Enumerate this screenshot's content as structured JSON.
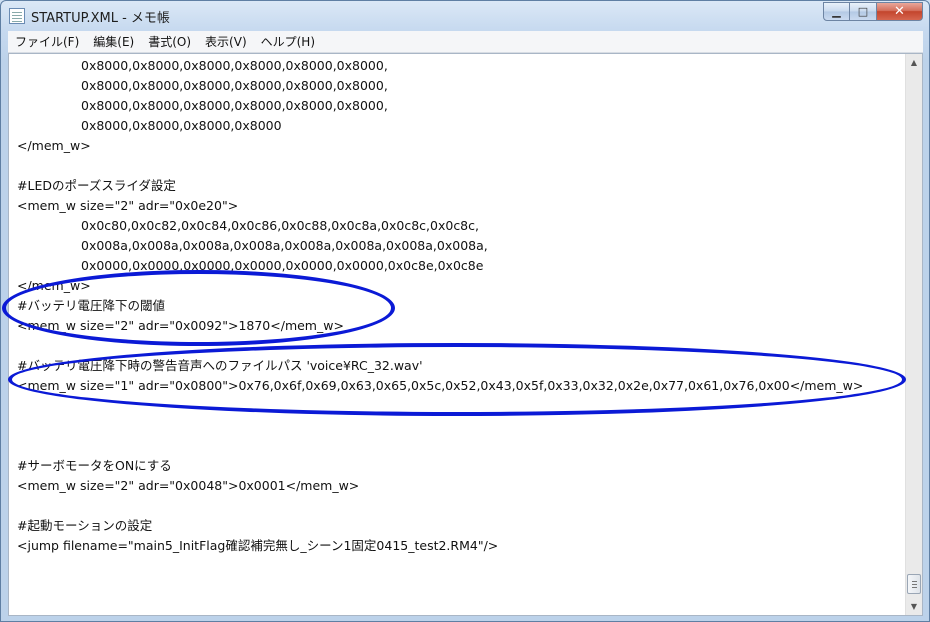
{
  "window": {
    "title": "STARTUP.XML - メモ帳",
    "minimize_glyph": "▁",
    "maximize_glyph": "□",
    "close_glyph": "✕"
  },
  "menu": {
    "items": [
      {
        "label": "ファイル(F)"
      },
      {
        "label": "編集(E)"
      },
      {
        "label": "書式(O)"
      },
      {
        "label": "表示(V)"
      },
      {
        "label": "ヘルプ(H)"
      }
    ]
  },
  "editor": {
    "lines": [
      {
        "text": "0x8000,0x8000,0x8000,0x8000,0x8000,0x8000,",
        "indent": true
      },
      {
        "text": "0x8000,0x8000,0x8000,0x8000,0x8000,0x8000,",
        "indent": true
      },
      {
        "text": "0x8000,0x8000,0x8000,0x8000,0x8000,0x8000,",
        "indent": true
      },
      {
        "text": "0x8000,0x8000,0x8000,0x8000",
        "indent": true
      },
      {
        "text": "</mem_w>",
        "indent": false
      },
      {
        "text": "",
        "indent": false
      },
      {
        "text": "#LEDのポーズスライダ設定",
        "indent": false
      },
      {
        "text": "<mem_w size=\"2\" adr=\"0x0e20\">",
        "indent": false
      },
      {
        "text": "0x0c80,0x0c82,0x0c84,0x0c86,0x0c88,0x0c8a,0x0c8c,0x0c8c,",
        "indent": true
      },
      {
        "text": "0x008a,0x008a,0x008a,0x008a,0x008a,0x008a,0x008a,0x008a,",
        "indent": true
      },
      {
        "text": "0x0000,0x0000,0x0000,0x0000,0x0000,0x0000,0x0c8e,0x0c8e",
        "indent": true
      },
      {
        "text": "</mem_w>",
        "indent": false
      },
      {
        "text": "#バッテリ電圧降下の閾値",
        "indent": false
      },
      {
        "text": "<mem_w size=\"2\" adr=\"0x0092\">1870</mem_w>",
        "indent": false
      },
      {
        "text": "",
        "indent": false
      },
      {
        "text": "#バッテリ電圧降下時の警告音声へのファイルパス 'voice¥RC_32.wav'",
        "indent": false
      },
      {
        "text": "<mem_w size=\"1\" adr=\"0x0800\">0x76,0x6f,0x69,0x63,0x65,0x5c,0x52,0x43,0x5f,0x33,0x32,0x2e,0x77,0x61,0x76,0x00</mem_w>",
        "indent": false
      },
      {
        "text": "",
        "indent": false
      },
      {
        "text": "",
        "indent": false
      },
      {
        "text": "",
        "indent": false
      },
      {
        "text": "#サーボモータをONにする",
        "indent": false
      },
      {
        "text": "<mem_w size=\"2\" adr=\"0x0048\">0x0001</mem_w>",
        "indent": false
      },
      {
        "text": "",
        "indent": false
      },
      {
        "text": "#起動モーションの設定",
        "indent": false
      },
      {
        "text": "<jump filename=\"main5_InitFlag確認補完無し_シーン1固定0415_test2.RM4\"/>",
        "indent": false
      }
    ]
  },
  "scrollbar": {
    "up_glyph": "▲",
    "down_glyph": "▼"
  },
  "annotation_color": "#0b1ad6"
}
